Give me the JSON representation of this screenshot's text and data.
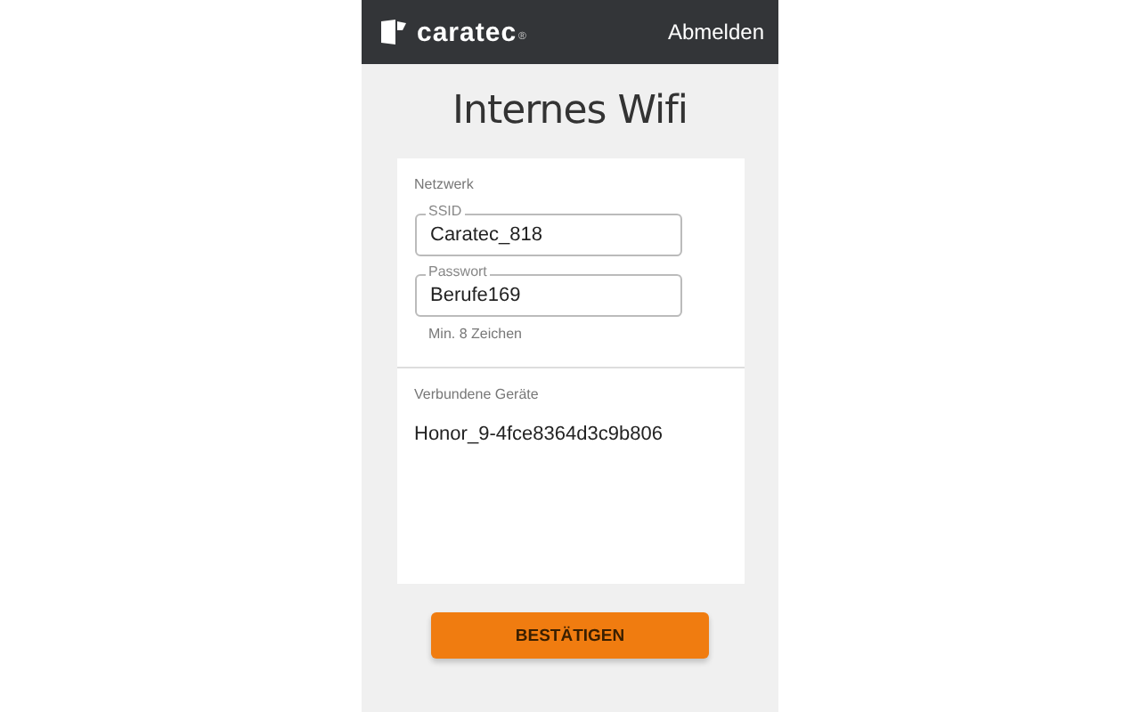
{
  "header": {
    "logo": "caratec",
    "logo_mark": "®",
    "logout_link": "Abmelden"
  },
  "title": "Internes Wifi",
  "network": {
    "heading": "Netzwerk",
    "fields": [
      {
        "label": "SSID",
        "value": "Caratec_818"
      },
      {
        "label": "Passwort",
        "value": "Berufe169",
        "hint": "Min. 8 Zeichen"
      }
    ]
  },
  "devices": {
    "heading": "Verbundene Geräte",
    "items": [
      "Honor_9-4fce8364d3c9b806"
    ]
  },
  "confirm_button": "BESTÄTIGEN"
}
